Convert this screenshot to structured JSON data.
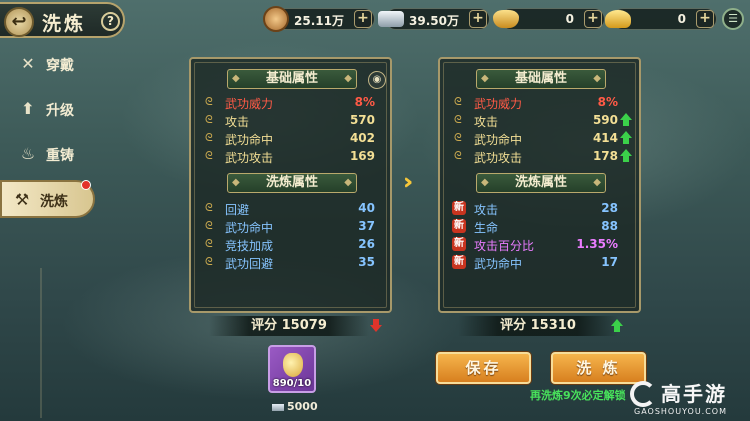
{
  "header": {
    "title": "洗炼",
    "back_icon": "back-arrow-icon",
    "help_label": "?"
  },
  "resources": [
    {
      "icon": "copper-coin-icon",
      "value": "25.11万",
      "color": "#d9a05a"
    },
    {
      "icon": "silver-ingot-icon",
      "value": "39.50万",
      "color": "#c9d6df"
    },
    {
      "icon": "gold-ingot-icon",
      "value": "0",
      "color": "#e6b83a"
    },
    {
      "icon": "gold-yuanbao-icon",
      "value": "0",
      "color": "#f0c744"
    }
  ],
  "menu_icon": "list-menu-icon",
  "sidebar": {
    "items": [
      {
        "label": "穿戴",
        "icon": "crossed-swords-icon"
      },
      {
        "label": "升级",
        "icon": "upgrade-arrow-icon"
      },
      {
        "label": "重铸",
        "icon": "flame-icon"
      },
      {
        "label": "洗炼",
        "icon": "anvil-icon",
        "active": true,
        "badge": true
      }
    ]
  },
  "left_panel": {
    "base_title": "基础属性",
    "base_rows": [
      {
        "name": "武功威力",
        "value": "8%",
        "color": "red"
      },
      {
        "name": "攻击",
        "value": "570",
        "color": "gold"
      },
      {
        "name": "武功命中",
        "value": "402",
        "color": "gold"
      },
      {
        "name": "武功攻击",
        "value": "169",
        "color": "gold"
      }
    ],
    "refine_title": "洗炼属性",
    "refine_rows": [
      {
        "name": "回避",
        "value": "40"
      },
      {
        "name": "武功命中",
        "value": "37"
      },
      {
        "name": "竞技加成",
        "value": "26"
      },
      {
        "name": "武功回避",
        "value": "35"
      }
    ],
    "score_label": "评分 15079",
    "score_trend": "down"
  },
  "right_panel": {
    "base_title": "基础属性",
    "base_rows": [
      {
        "name": "武功威力",
        "value": "8%",
        "color": "red",
        "up": false
      },
      {
        "name": "攻击",
        "value": "590",
        "color": "gold",
        "up": true
      },
      {
        "name": "武功命中",
        "value": "414",
        "color": "gold",
        "up": true
      },
      {
        "name": "武功攻击",
        "value": "178",
        "color": "gold",
        "up": true
      }
    ],
    "refine_title": "洗炼属性",
    "new_tag": "新",
    "refine_rows": [
      {
        "name": "攻击",
        "value": "28",
        "color": "blue"
      },
      {
        "name": "生命",
        "value": "88",
        "color": "blue"
      },
      {
        "name": "攻击百分比",
        "value": "1.35%",
        "color": "purple"
      },
      {
        "name": "武功命中",
        "value": "17",
        "color": "blue"
      }
    ],
    "score_label": "评分 15310",
    "score_trend": "up"
  },
  "item": {
    "icon": "refine-potion-icon",
    "count": "890/10",
    "cost": "5000",
    "cost_icon": "silver-ingot-icon"
  },
  "buttons": {
    "save": "保存",
    "refine": "洗 炼"
  },
  "hint": "再洗炼9次必定解锁",
  "watermark": {
    "brand": "高手游",
    "url": "GAOSHOUYOU.COM"
  }
}
